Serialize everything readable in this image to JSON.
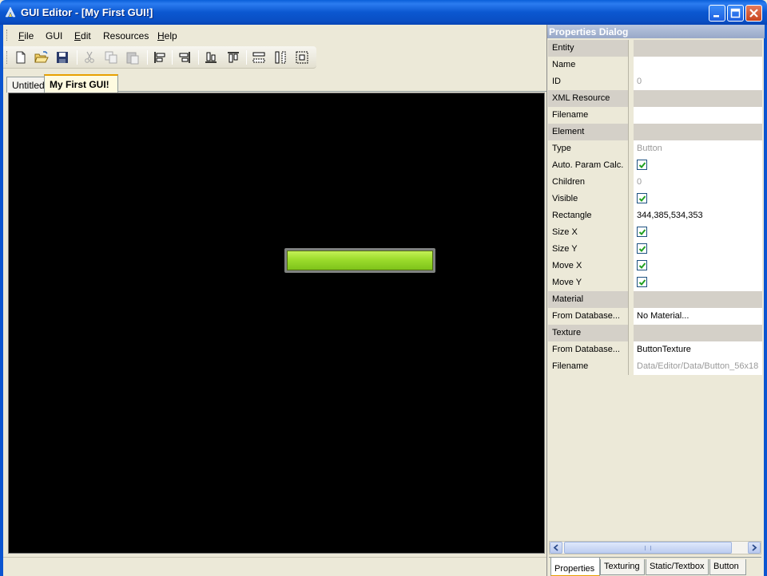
{
  "window": {
    "title": "GUI Editor - [My First GUI!]",
    "icons": [
      "app-icon",
      "minimize-icon",
      "maximize-icon",
      "close-icon"
    ]
  },
  "menu": {
    "items": [
      {
        "label": "File",
        "mnemonic": "F"
      },
      {
        "label": "GUI"
      },
      {
        "label": "Edit",
        "mnemonic": "E"
      },
      {
        "label": "Resources"
      },
      {
        "label": "Help",
        "mnemonic": "H"
      }
    ]
  },
  "toolbar": {
    "icons": [
      "new-file-icon",
      "open-folder-icon",
      "save-icon",
      "cut-icon",
      "copy-icon",
      "paste-icon",
      "align-left-icon",
      "align-right-icon",
      "align-bottom-icon",
      "align-top-icon",
      "same-width-icon",
      "same-height-icon",
      "same-size-icon"
    ]
  },
  "tabs": [
    {
      "label": "Untitled"
    },
    {
      "label": "My First GUI!"
    }
  ],
  "canvas": {
    "background": "#000000",
    "element_color": "#9cdd2c"
  },
  "properties": {
    "title": "Properties Dialog",
    "rows": [
      {
        "label": "Entity",
        "value": "",
        "category": true
      },
      {
        "label": "Name",
        "value": ""
      },
      {
        "label": "ID",
        "value": "0",
        "readonly": true
      },
      {
        "label": "XML Resource",
        "value": "",
        "category": true
      },
      {
        "label": "Filename",
        "value": ""
      },
      {
        "label": "Element",
        "value": "",
        "category": true
      },
      {
        "label": "Type",
        "value": "Button",
        "readonly": true
      },
      {
        "label": "Auto. Param Calc.",
        "checked": true
      },
      {
        "label": "Children",
        "value": "0",
        "readonly": true
      },
      {
        "label": "Visible",
        "checked": true
      },
      {
        "label": "Rectangle",
        "value": "344,385,534,353"
      },
      {
        "label": "Size X",
        "checked": true
      },
      {
        "label": "Size Y",
        "checked": true
      },
      {
        "label": "Move X",
        "checked": true
      },
      {
        "label": "Move Y",
        "checked": true
      },
      {
        "label": "Material",
        "value": "",
        "category": true
      },
      {
        "label": "From Database...",
        "value": "No Material..."
      },
      {
        "label": "Texture",
        "value": "",
        "category": true
      },
      {
        "label": "From Database...",
        "value": "ButtonTexture"
      },
      {
        "label": "Filename",
        "value": "Data/Editor/Data/Button_56x18",
        "readonly": true
      }
    ],
    "bottom_tabs": [
      {
        "label": "Properties"
      },
      {
        "label": "Texturing"
      },
      {
        "label": "Static/Textbox"
      },
      {
        "label": "Button"
      }
    ]
  }
}
